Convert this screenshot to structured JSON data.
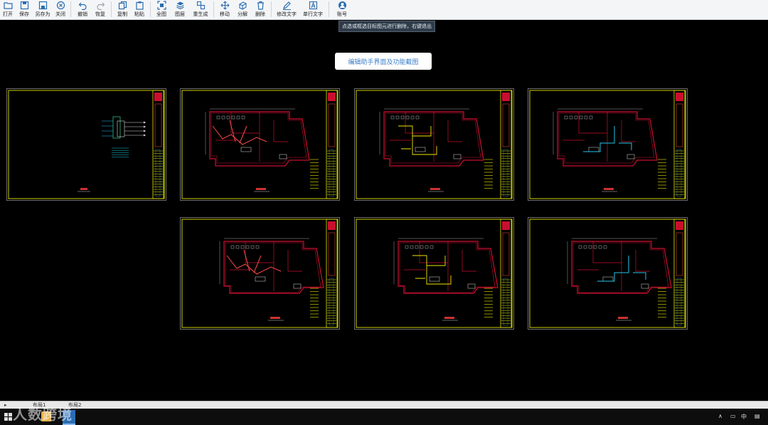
{
  "toolbar": {
    "buttons": [
      {
        "id": "open",
        "label": "打开",
        "icon": "folder-open-icon"
      },
      {
        "id": "save",
        "label": "保存",
        "icon": "save-icon"
      },
      {
        "id": "saveas",
        "label": "另存为",
        "icon": "save-as-icon"
      },
      {
        "id": "close",
        "label": "关闭",
        "icon": "close-circle-icon"
      },
      {
        "id": "undo",
        "label": "撤销",
        "icon": "undo-icon"
      },
      {
        "id": "redo",
        "label": "恢复",
        "icon": "redo-icon"
      },
      {
        "id": "copy",
        "label": "复制",
        "icon": "copy-icon"
      },
      {
        "id": "paste",
        "label": "粘贴",
        "icon": "paste-icon"
      },
      {
        "id": "fullview",
        "label": "全图",
        "icon": "fit-view-icon"
      },
      {
        "id": "layers",
        "label": "图层",
        "icon": "layers-icon"
      },
      {
        "id": "regen",
        "label": "重生成",
        "icon": "regenerate-icon"
      },
      {
        "id": "move",
        "label": "移动",
        "icon": "move-icon"
      },
      {
        "id": "explode",
        "label": "分解",
        "icon": "explode-icon"
      },
      {
        "id": "delete",
        "label": "删除",
        "icon": "trash-icon"
      },
      {
        "id": "edittext",
        "label": "修改文字",
        "icon": "pen-icon"
      },
      {
        "id": "singletext",
        "label": "单行文字",
        "icon": "text-box-icon"
      },
      {
        "id": "account",
        "label": "账号",
        "icon": "user-icon"
      }
    ]
  },
  "tooltip": "点选或框选目标图元进行删除，右键退出",
  "title_badge": "编辑助手界面及功能截图",
  "status": {
    "tab1": "布局1",
    "tab2": "布局2"
  },
  "taskbar": {
    "ime": "中"
  },
  "watermark": "人数跨境",
  "colors": {
    "sheet_border": "#e8e800",
    "wall": "#c8102e",
    "accent": "#3d7ec6"
  }
}
